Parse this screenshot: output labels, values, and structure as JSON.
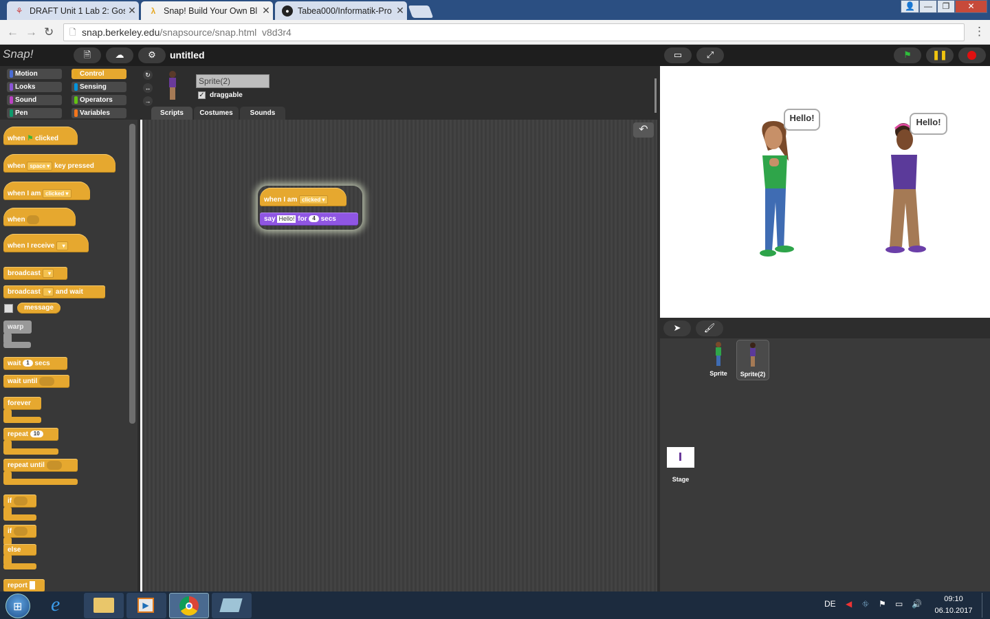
{
  "browser": {
    "tabs": [
      {
        "title": "DRAFT Unit 1 Lab 2: Goss"
      },
      {
        "title": "Snap! Build Your Own Bl"
      },
      {
        "title": "Tabea000/Informatik-Pro"
      }
    ],
    "url_host": "snap.berkeley.edu",
    "url_path": "/snapsource/snap.html",
    "url_extra": "v8d3r4"
  },
  "snap": {
    "logo": "Snap!",
    "project_title": "untitled",
    "categories": [
      "Motion",
      "Looks",
      "Sound",
      "Pen",
      "Control",
      "Sensing",
      "Operators",
      "Variables"
    ],
    "category_colors": [
      "#4a6cd4",
      "#8a55d7",
      "#bb42c3",
      "#0e9a6c",
      "#e6a822",
      "#0494dc",
      "#62c213",
      "#f3761d"
    ],
    "selected_category": "Control",
    "palette": {
      "when_flag": [
        "when",
        "clicked"
      ],
      "when_key": [
        "when",
        "space",
        "key pressed"
      ],
      "when_i_am": [
        "when I am",
        "clicked"
      ],
      "when": "when",
      "when_receive": "when I receive",
      "broadcast": "broadcast",
      "broadcast_wait": [
        "broadcast",
        "and wait"
      ],
      "message": "message",
      "warp": "warp",
      "wait_secs": [
        "wait",
        "1",
        "secs"
      ],
      "wait_until": "wait until",
      "forever": "forever",
      "repeat": [
        "repeat",
        "10"
      ],
      "repeat_until": "repeat until",
      "if": "if",
      "else": "else",
      "report": "report"
    },
    "sprite": {
      "name": "Sprite(2)",
      "draggable_label": "draggable"
    },
    "tabs": [
      "Scripts",
      "Costumes",
      "Sounds"
    ],
    "script": {
      "hat": [
        "when I am",
        "clicked"
      ],
      "say": [
        "say",
        "Hello!",
        "for",
        "4",
        "secs"
      ]
    },
    "stage_bubbles": [
      "Hello!",
      "Hello!"
    ],
    "corral": {
      "sprites": [
        "Sprite",
        "Sprite(2)"
      ],
      "stage": "Stage"
    }
  },
  "taskbar": {
    "lang": "DE",
    "time": "09:10",
    "date": "06.10.2017"
  }
}
